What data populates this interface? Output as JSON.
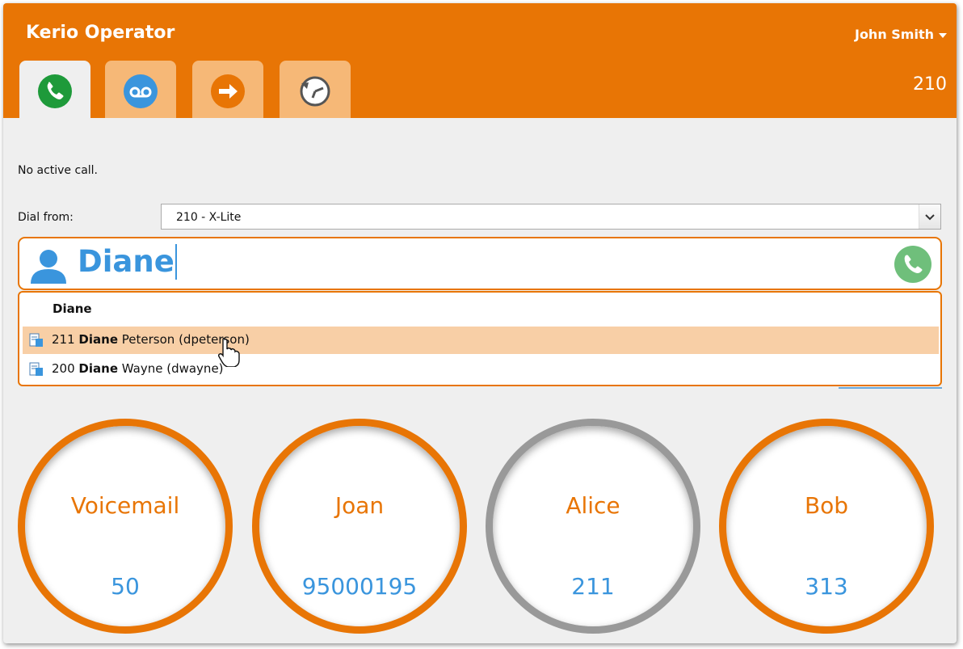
{
  "header": {
    "app_title": "Kerio Operator",
    "user_name": "John Smith",
    "extension": "210"
  },
  "tabs": [
    {
      "icon": "phone-icon",
      "color": "#1e9a3a",
      "active": true
    },
    {
      "icon": "voicemail-icon",
      "color": "#3a95dd",
      "active": false
    },
    {
      "icon": "forward-arrow-icon",
      "color": "#e87505",
      "active": false
    },
    {
      "icon": "call-history-icon",
      "color": "#555555",
      "active": false
    }
  ],
  "call": {
    "status": "No active call.",
    "dial_from_label": "Dial from:",
    "dial_from_value": "210 - X-Lite"
  },
  "search": {
    "value": "Diane"
  },
  "suggestions": {
    "header": "Diane",
    "items": [
      {
        "ext": "211",
        "first": "Diane",
        "rest": "Peterson (dpeterson)",
        "highlighted": true
      },
      {
        "ext": "200",
        "first": "Diane",
        "rest": "Wayne (dwayne)",
        "highlighted": false
      }
    ]
  },
  "speed_dials": [
    {
      "name": "Voicemail",
      "number": "50",
      "active": true
    },
    {
      "name": "Joan",
      "number": "95000195",
      "active": true
    },
    {
      "name": "Alice",
      "number": "211",
      "active": false
    },
    {
      "name": "Bob",
      "number": "313",
      "active": true
    }
  ],
  "colors": {
    "accent": "#e87505",
    "link_blue": "#3a95dd",
    "call_green": "#1e9a3a",
    "highlight": "#f8cfa6"
  }
}
